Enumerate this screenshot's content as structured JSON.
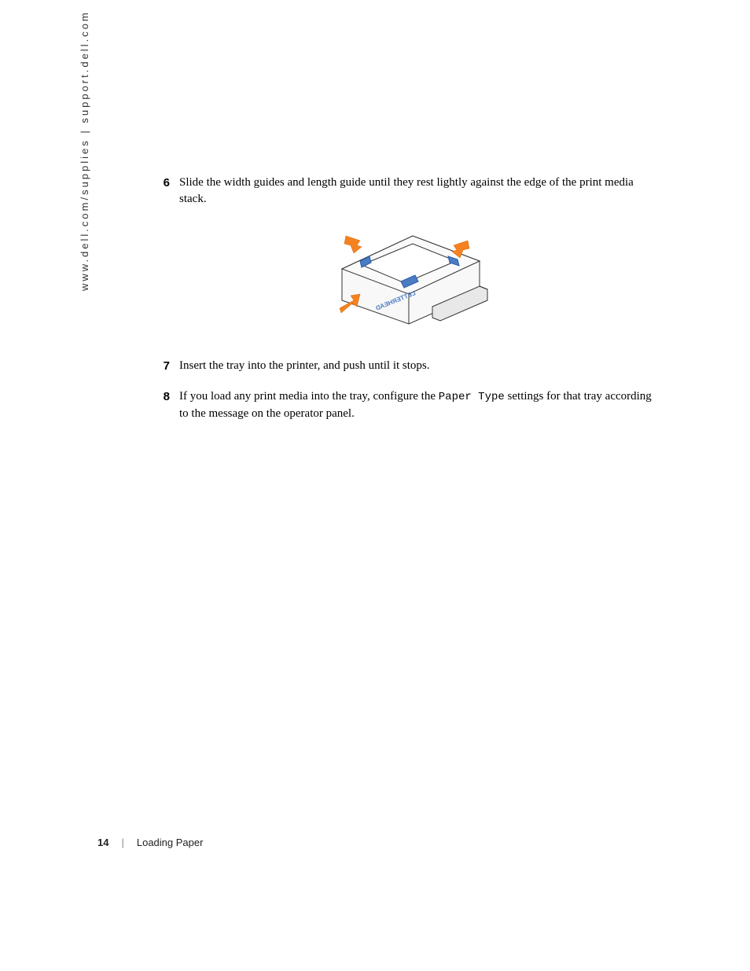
{
  "sidebar": {
    "url_text": "www.dell.com/supplies | support.dell.com"
  },
  "steps": [
    {
      "number": "6",
      "text": "Slide the width guides and length guide until they rest lightly against the edge of the print media stack."
    },
    {
      "number": "7",
      "text": "Insert the tray into the printer, and push until it stops."
    },
    {
      "number": "8",
      "text_before": "If you load any print media into the tray, configure the ",
      "code": "Paper Type",
      "text_after": " settings for that tray according to the message on the operator panel."
    }
  ],
  "figure": {
    "label": "LETTERHEAD"
  },
  "footer": {
    "page": "14",
    "divider": "|",
    "section": "Loading Paper"
  }
}
